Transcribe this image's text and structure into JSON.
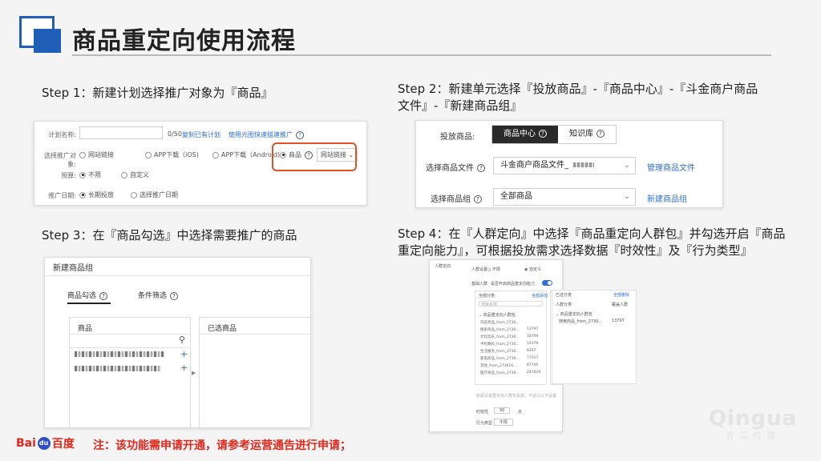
{
  "page": {
    "title": "商品重定向使用流程",
    "footnote": "注：该功能需申请开通，请参考运营通告进行申请；",
    "brand": "百度",
    "brand_prefix": "Bai",
    "watermark_main": "Qingua",
    "watermark_sub": "青瓜传媒"
  },
  "steps": [
    {
      "label": "Step 1：新建计划选择推广对象为『商品』"
    },
    {
      "label": "Step 2：新建单元选择『投放商品』-『商品中心』-『斗金商户商品文件』-『新建商品组』"
    },
    {
      "label": "Step 3：在『商品勾选』中选择需要推广的商品"
    },
    {
      "label": "Step 4：在『人群定向』中选择『商品重定向人群包』并勾选开启『商品重定向能力』，可根据投放需求选择数据『时效性』及『行为类型』"
    }
  ],
  "panel1": {
    "plan_name_label": "计划名称:",
    "counter": "0/50",
    "copy_link": "复制已有计划",
    "template_link": "使用元图快速搭建推广",
    "target_label": "选择推广对象:",
    "opt_website": "网站链接",
    "opt_app_ios": "APP下载（iOS)",
    "opt_app_android": "APP下载（Android)",
    "opt_product": "商品",
    "product_select": "网站链接",
    "budget_label": "预算:",
    "budget_opt1": "不限",
    "budget_opt2": "自定义",
    "date_label": "推广日期:",
    "date_opt1": "长期投放",
    "date_opt2": "选择推广日期"
  },
  "panel2": {
    "deliver_label": "投放商品:",
    "tab_center": "商品中心",
    "tab_knowledge": "知识库",
    "file_label": "选择商品文件",
    "file_value": "斗金商户商品文件_",
    "manage_link": "管理商品文件",
    "group_label": "选择商品组",
    "group_value": "全部商品",
    "new_group_link": "新建商品组"
  },
  "panel3": {
    "title": "新建商品组",
    "tab_check": "商品勾选",
    "tab_filter": "条件筛选",
    "col_products": "商品",
    "col_selected": "已选商品",
    "plus_1": "+",
    "plus_2": "+"
  },
  "panel4": {
    "section": "人群定向",
    "crowd_setting": "人群设置",
    "no_limit": "不限",
    "custom": "自定义",
    "exclude": "基础人群",
    "retarget_toggle_label": "是否开启商品重定向能力",
    "all_category": "全部分类",
    "select_all": "全部添加",
    "search": "搜索名称",
    "selected_category": "已选分类",
    "clear_all": "全部删除",
    "crowd_category": "人群分类",
    "crowd_count": "覆盖人群",
    "package": "商品重定向人群包",
    "rows": [
      {
        "name": "浏览商品_from_2730...",
        "count": ""
      },
      {
        "name": "搜索商品_from_2730...",
        "count": "13797"
      },
      {
        "name": "文化玩乐_from_2730...",
        "count": "78799"
      },
      {
        "name": "手机数码_from_2730...",
        "count": "14379"
      },
      {
        "name": "生活服务_from_2730...",
        "count": "8297"
      },
      {
        "name": "家电商品_from_2730...",
        "count": "77017"
      },
      {
        "name": "其他_from_273016...",
        "count": "87740"
      },
      {
        "name": "医疗商品_from_2730...",
        "count": "243429"
      }
    ],
    "selected_row_name": "搜索商品_from_2730...",
    "selected_row_count": "13797",
    "hint": "如需设置重定向人群包投放，可进行以下设置",
    "timeliness_label": "时效性",
    "timeliness_value": "90",
    "behavior_label": "行为类型",
    "behavior_value": "不限",
    "day_unit": "天"
  }
}
